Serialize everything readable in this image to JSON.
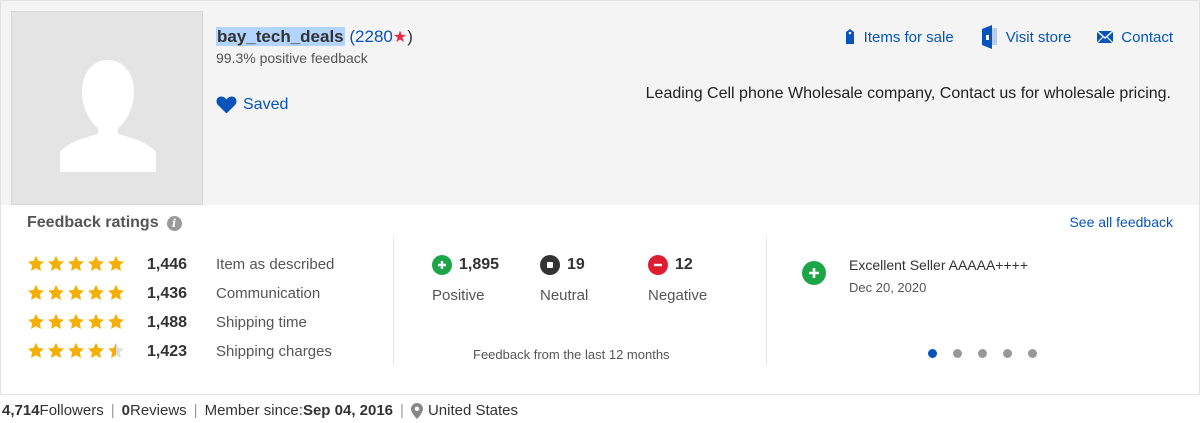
{
  "seller": {
    "username": "bay_tech_deals",
    "score_open": "(",
    "score": "2280",
    "score_star": "★",
    "score_close": ")",
    "positive_feedback": "99.3% positive feedback",
    "saved_label": "Saved",
    "description": "Leading Cell phone Wholesale company, Contact us for wholesale pricing."
  },
  "header_links": [
    {
      "label": "Items for sale",
      "icon": "tag-icon"
    },
    {
      "label": "Visit store",
      "icon": "store-icon"
    },
    {
      "label": "Contact",
      "icon": "mail-icon"
    }
  ],
  "feedback": {
    "title": "Feedback ratings",
    "see_all": "See all feedback",
    "ratings": [
      {
        "stars": 5,
        "count": "1,446",
        "label": "Item as described"
      },
      {
        "stars": 5,
        "count": "1,436",
        "label": "Communication"
      },
      {
        "stars": 5,
        "count": "1,488",
        "label": "Shipping time"
      },
      {
        "stars": 4.5,
        "count": "1,423",
        "label": "Shipping charges"
      }
    ],
    "counts": {
      "positive": {
        "value": "1,895",
        "label": "Positive"
      },
      "neutral": {
        "value": "19",
        "label": "Neutral"
      },
      "negative": {
        "value": "12",
        "label": "Negative"
      }
    },
    "period_note": "Feedback from the last 12 months",
    "latest": {
      "text": "Excellent Seller AAAAA++++",
      "date": "Dec 20, 2020"
    },
    "carousel": {
      "total": 5,
      "active": 0
    }
  },
  "bottom": {
    "followers_count": "4,714",
    "followers_label": " Followers",
    "reviews_count": "0",
    "reviews_label": " Reviews",
    "member_label": "Member since: ",
    "member_date": "Sep 04, 2016",
    "location": "United States",
    "separator": "|"
  },
  "colors": {
    "link": "#0654ba",
    "star": "#f5af02",
    "positive": "#1ea548",
    "neutral": "#333333",
    "negative": "#dd1e31",
    "score_star": "#e42648"
  }
}
